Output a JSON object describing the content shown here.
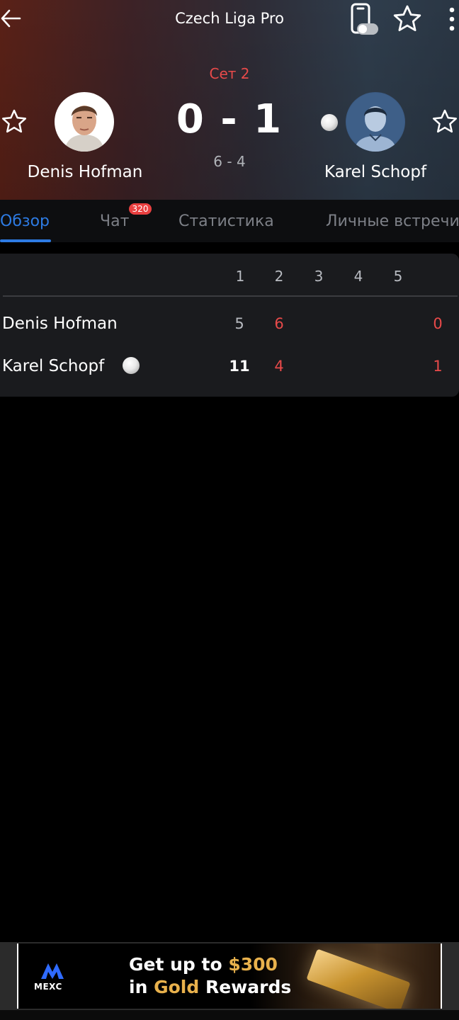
{
  "header": {
    "title": "Czech Liga Pro",
    "set_label": "Сет 2",
    "score": "0 - 1",
    "set_score": "6 - 4",
    "player1": {
      "name": "Denis Hofman"
    },
    "player2": {
      "name": "Karel Schopf"
    }
  },
  "tabs": [
    {
      "label": "Обзор",
      "active": true
    },
    {
      "label": "Чат",
      "badge": "320"
    },
    {
      "label": "Статистика"
    },
    {
      "label": "Личные встречи"
    }
  ],
  "scoreboard": {
    "columns": [
      "1",
      "2",
      "3",
      "4",
      "5"
    ],
    "rows": [
      {
        "name": "Denis Hofman",
        "set1": "5",
        "set2": "6",
        "total": "0",
        "serving": false
      },
      {
        "name": "Karel Schopf",
        "set1": "11",
        "set2": "4",
        "total": "1",
        "serving": true
      }
    ]
  },
  "ad": {
    "brand": "MEXC",
    "line1_a": "Get up to ",
    "line1_b": "$300",
    "line2_a": "in ",
    "line2_b": "Gold",
    "line2_c": " Rewards"
  },
  "icons": [
    "back-arrow-icon",
    "phone-toggle-icon",
    "star-icon",
    "more-vert-icon",
    "tennis-ball-icon"
  ],
  "colors": {
    "accent": "#2d7be3",
    "red": "#e84a4a",
    "badge": "#e84040"
  }
}
